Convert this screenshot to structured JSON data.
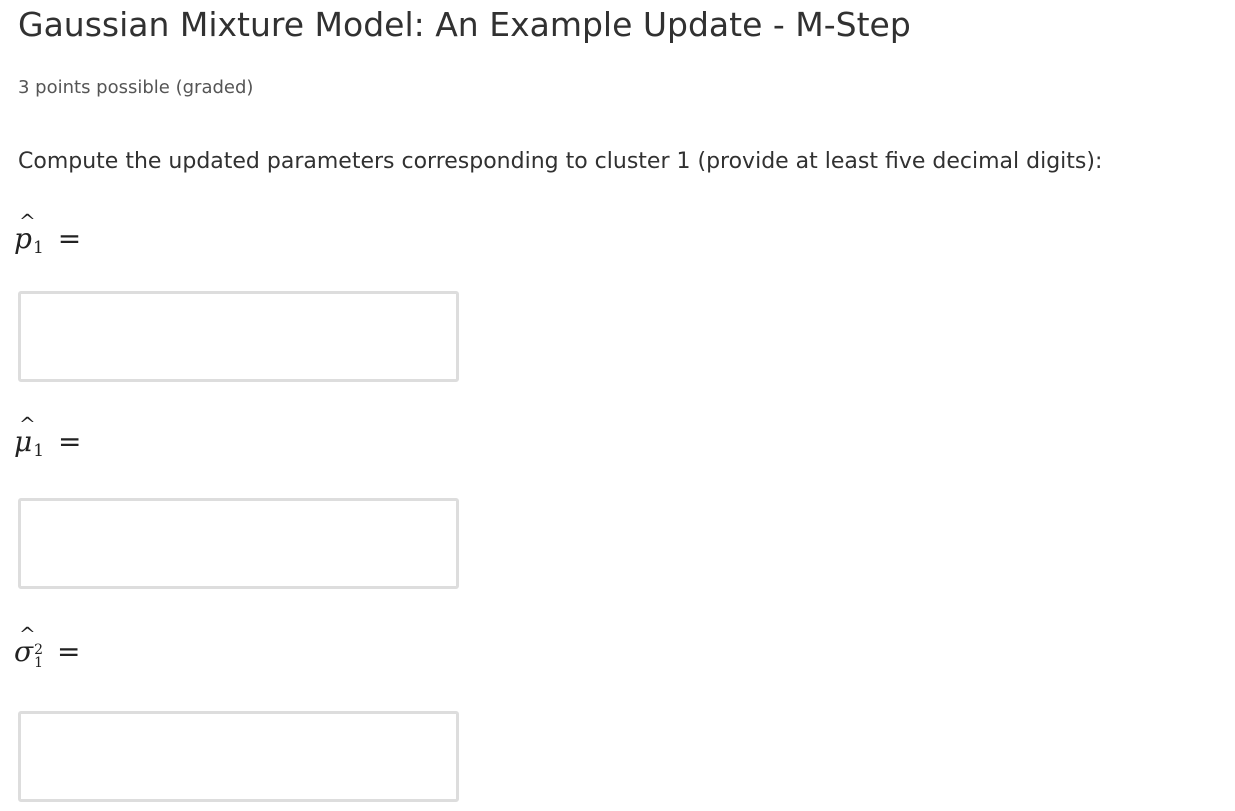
{
  "problem": {
    "title": "Gaussian Mixture Model: An Example Update - M-Step",
    "points_note": "3 points possible (graded)",
    "prompt": "Compute the updated parameters corresponding to cluster 1 (provide at least five decimal digits):"
  },
  "parameters": [
    {
      "symbol": "p",
      "accent": "^",
      "subscript": "1",
      "superscript": "",
      "relation": "=",
      "input_value": "",
      "placeholder": ""
    },
    {
      "symbol": "μ",
      "accent": "^",
      "subscript": "1",
      "superscript": "",
      "relation": "=",
      "input_value": "",
      "placeholder": ""
    },
    {
      "symbol": "σ",
      "accent": "^",
      "subscript": "1",
      "superscript": "2",
      "relation": "=",
      "input_value": "",
      "placeholder": ""
    }
  ]
}
